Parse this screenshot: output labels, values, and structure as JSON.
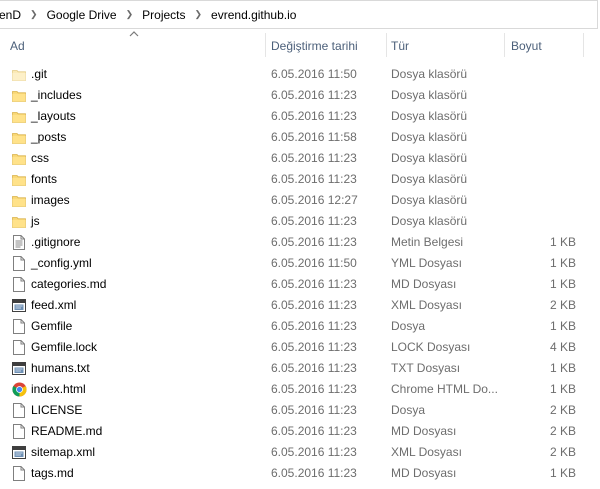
{
  "breadcrumb": [
    "enD",
    "Google Drive",
    "Projects",
    "evrend.github.io"
  ],
  "columns": {
    "name": "Ad",
    "date": "Değiştirme tarihi",
    "type": "Tür",
    "size": "Boyut"
  },
  "files": [
    {
      "name": ".git",
      "date": "6.05.2016 11:50",
      "type": "Dosya klasörü",
      "size": "",
      "icon": "folder-light-icon"
    },
    {
      "name": "_includes",
      "date": "6.05.2016 11:23",
      "type": "Dosya klasörü",
      "size": "",
      "icon": "folder-icon"
    },
    {
      "name": "_layouts",
      "date": "6.05.2016 11:23",
      "type": "Dosya klasörü",
      "size": "",
      "icon": "folder-icon"
    },
    {
      "name": "_posts",
      "date": "6.05.2016 11:58",
      "type": "Dosya klasörü",
      "size": "",
      "icon": "folder-icon"
    },
    {
      "name": "css",
      "date": "6.05.2016 11:23",
      "type": "Dosya klasörü",
      "size": "",
      "icon": "folder-icon"
    },
    {
      "name": "fonts",
      "date": "6.05.2016 11:23",
      "type": "Dosya klasörü",
      "size": "",
      "icon": "folder-icon"
    },
    {
      "name": "images",
      "date": "6.05.2016 12:27",
      "type": "Dosya klasörü",
      "size": "",
      "icon": "folder-icon"
    },
    {
      "name": "js",
      "date": "6.05.2016 11:23",
      "type": "Dosya klasörü",
      "size": "",
      "icon": "folder-icon"
    },
    {
      "name": ".gitignore",
      "date": "6.05.2016 11:23",
      "type": "Metin Belgesi",
      "size": "1 KB",
      "icon": "text-document-icon"
    },
    {
      "name": "_config.yml",
      "date": "6.05.2016 11:50",
      "type": "YML Dosyası",
      "size": "1 KB",
      "icon": "blank-document-icon"
    },
    {
      "name": "categories.md",
      "date": "6.05.2016 11:23",
      "type": "MD Dosyası",
      "size": "1 KB",
      "icon": "blank-document-icon"
    },
    {
      "name": "feed.xml",
      "date": "6.05.2016 11:23",
      "type": "XML Dosyası",
      "size": "2 KB",
      "icon": "xml-document-icon"
    },
    {
      "name": "Gemfile",
      "date": "6.05.2016 11:23",
      "type": "Dosya",
      "size": "1 KB",
      "icon": "blank-document-icon"
    },
    {
      "name": "Gemfile.lock",
      "date": "6.05.2016 11:23",
      "type": "LOCK Dosyası",
      "size": "4 KB",
      "icon": "blank-document-icon"
    },
    {
      "name": "humans.txt",
      "date": "6.05.2016 11:23",
      "type": "TXT Dosyası",
      "size": "1 KB",
      "icon": "xml-document-icon"
    },
    {
      "name": "index.html",
      "date": "6.05.2016 11:23",
      "type": "Chrome HTML Do...",
      "size": "1 KB",
      "icon": "chrome-icon"
    },
    {
      "name": "LICENSE",
      "date": "6.05.2016 11:23",
      "type": "Dosya",
      "size": "2 KB",
      "icon": "blank-document-icon"
    },
    {
      "name": "README.md",
      "date": "6.05.2016 11:23",
      "type": "MD Dosyası",
      "size": "2 KB",
      "icon": "blank-document-icon"
    },
    {
      "name": "sitemap.xml",
      "date": "6.05.2016 11:23",
      "type": "XML Dosyası",
      "size": "2 KB",
      "icon": "xml-document-icon"
    },
    {
      "name": "tags.md",
      "date": "6.05.2016 11:23",
      "type": "MD Dosyası",
      "size": "1 KB",
      "icon": "blank-document-icon"
    }
  ]
}
